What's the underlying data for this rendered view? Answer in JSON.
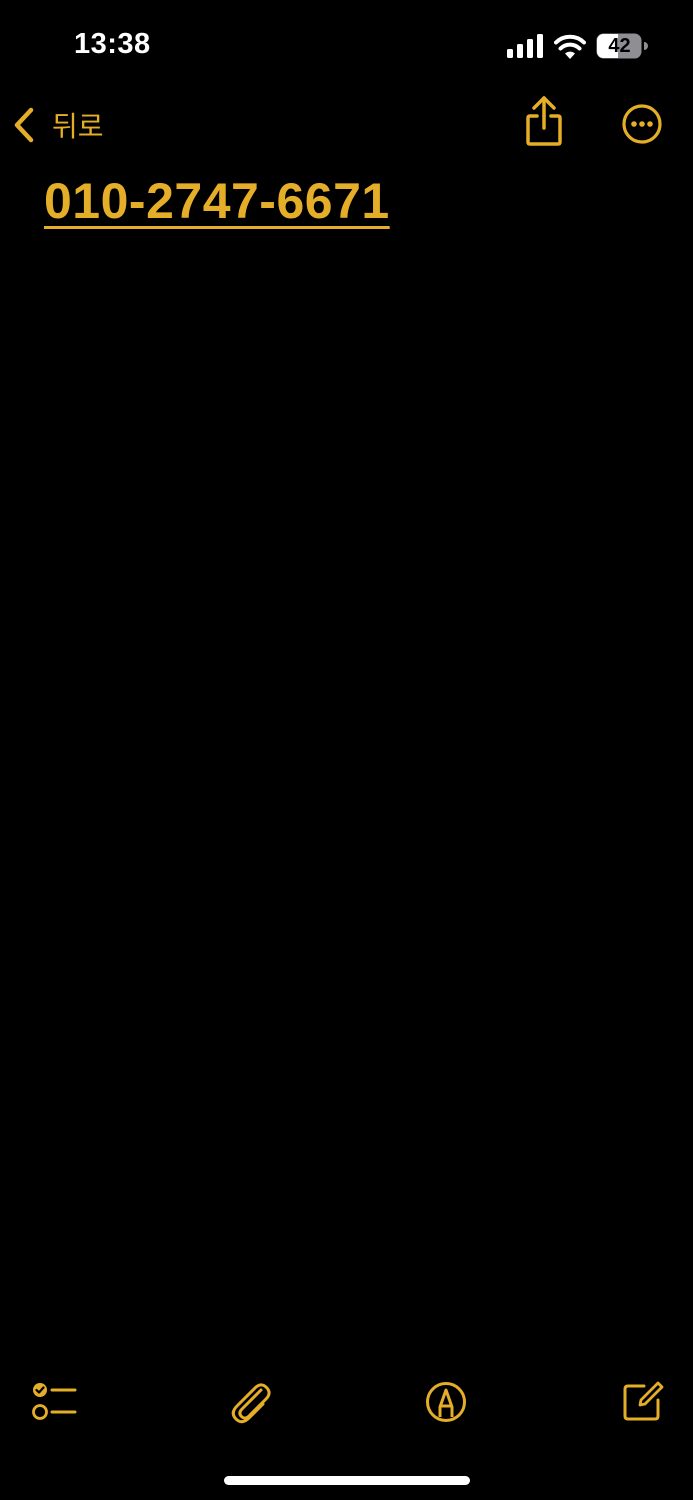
{
  "status_bar": {
    "time": "13:38",
    "battery_level": "42",
    "icons": [
      "signal-icon",
      "wifi-icon",
      "battery-icon"
    ]
  },
  "nav": {
    "back_label": "뒤로",
    "icons": [
      "chevron-left-icon",
      "share-icon",
      "more-icon"
    ]
  },
  "note": {
    "phone_number": "010-2747-6671"
  },
  "toolbar": {
    "icons": [
      "checklist-icon",
      "paperclip-icon",
      "markup-pen-icon",
      "compose-icon"
    ]
  },
  "colors": {
    "accent": "#E5AE28",
    "background": "#000000",
    "text": "#FFFFFF"
  }
}
